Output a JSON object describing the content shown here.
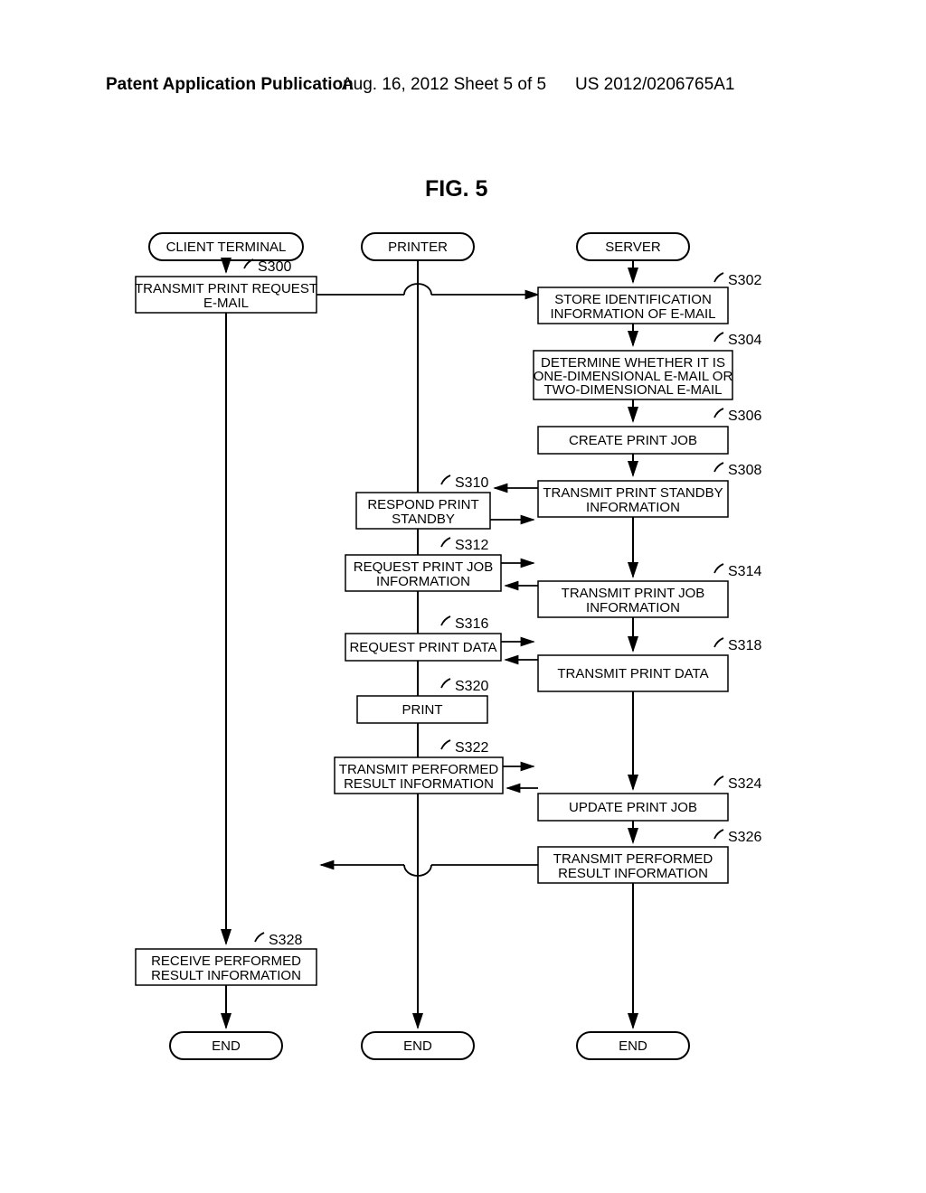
{
  "header": {
    "left": "Patent Application Publication",
    "center": "Aug. 16, 2012  Sheet 5 of 5",
    "right": "US 2012/0206765A1"
  },
  "figure_title": "FIG. 5",
  "lanes": {
    "client": "CLIENT TERMINAL",
    "printer": "PRINTER",
    "server": "SERVER",
    "end": "END"
  },
  "steps": {
    "s300": {
      "tag": "S300",
      "text1": "TRANSMIT PRINT REQUEST",
      "text2": "E-MAIL"
    },
    "s302": {
      "tag": "S302",
      "text1": "STORE IDENTIFICATION",
      "text2": "INFORMATION OF E-MAIL"
    },
    "s304": {
      "tag": "S304",
      "text1": "DETERMINE WHETHER IT IS",
      "text2": "ONE-DIMENSIONAL E-MAIL OR",
      "text3": "TWO-DIMENSIONAL E-MAIL"
    },
    "s306": {
      "tag": "S306",
      "text1": "CREATE PRINT JOB"
    },
    "s308": {
      "tag": "S308",
      "text1": "TRANSMIT PRINT STANDBY",
      "text2": "INFORMATION"
    },
    "s310": {
      "tag": "S310",
      "text1": "RESPOND PRINT",
      "text2": "STANDBY"
    },
    "s312": {
      "tag": "S312",
      "text1": "REQUEST PRINT JOB",
      "text2": "INFORMATION"
    },
    "s314": {
      "tag": "S314",
      "text1": "TRANSMIT PRINT JOB",
      "text2": "INFORMATION"
    },
    "s316": {
      "tag": "S316",
      "text1": "REQUEST PRINT DATA"
    },
    "s318": {
      "tag": "S318",
      "text1": "TRANSMIT PRINT DATA"
    },
    "s320": {
      "tag": "S320",
      "text1": "PRINT"
    },
    "s322": {
      "tag": "S322",
      "text1": "TRANSMIT PERFORMED",
      "text2": "RESULT INFORMATION"
    },
    "s324": {
      "tag": "S324",
      "text1": "UPDATE PRINT JOB"
    },
    "s326": {
      "tag": "S326",
      "text1": "TRANSMIT PERFORMED",
      "text2": "RESULT INFORMATION"
    },
    "s328": {
      "tag": "S328",
      "text1": "RECEIVE PERFORMED",
      "text2": "RESULT INFORMATION"
    }
  }
}
